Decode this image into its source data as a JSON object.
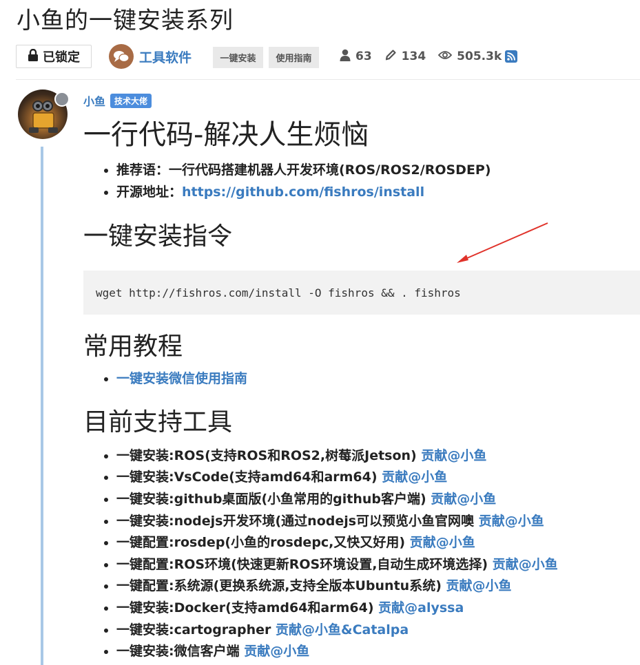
{
  "topic": {
    "title": "小鱼的一键安装系列"
  },
  "meta": {
    "locked_label": "已锁定",
    "category": "工具软件",
    "tags": [
      "一键安装",
      "使用指南"
    ],
    "participants": "63",
    "posts": "134",
    "views": "505.3k",
    "icons": [
      "lock-icon",
      "chat-bubble-icon",
      "user-icon",
      "pencil-icon",
      "eye-icon",
      "rss-icon"
    ]
  },
  "post": {
    "author": "小鱼",
    "author_title": "技术大佬",
    "heading": "一行代码-解决人生烦恼",
    "intro": [
      {
        "text": "推荐语：一行代码搭建机器人开发环境(ROS/ROS2/ROSDEP)",
        "link": ""
      },
      {
        "text": "开源地址：",
        "link": "https://github.com/fishros/install"
      }
    ],
    "install_heading": "一键安装指令",
    "install_command": "wget http://fishros.com/install -O fishros && . fishros",
    "tutorials_heading": "常用教程",
    "tutorials": [
      "一键安装微信使用指南"
    ],
    "tools_heading": "目前支持工具",
    "tools": [
      {
        "text": "一键安装:ROS(支持ROS和ROS2,树莓派Jetson)",
        "contrib": "贡献@小鱼"
      },
      {
        "text": "一键安装:VsCode(支持amd64和arm64)",
        "contrib": "贡献@小鱼"
      },
      {
        "text": "一键安装:github桌面版(小鱼常用的github客户端)",
        "contrib": "贡献@小鱼"
      },
      {
        "text": "一键安装:nodejs开发环境(通过nodejs可以预览小鱼官网噢",
        "contrib": "贡献@小鱼"
      },
      {
        "text": "一键配置:rosdep(小鱼的rosdepc,又快又好用)",
        "contrib": "贡献@小鱼"
      },
      {
        "text": "一键配置:ROS环境(快速更新ROS环境设置,自动生成环境选择)",
        "contrib": "贡献@小鱼"
      },
      {
        "text": "一键配置:系统源(更换系统源,支持全版本Ubuntu系统)",
        "contrib": "贡献@小鱼"
      },
      {
        "text": "一键安装:Docker(支持amd64和arm64)",
        "contrib": "贡献@alyssa"
      },
      {
        "text": "一键安装:cartographer",
        "contrib": "贡献@小鱼&Catalpa"
      },
      {
        "text": "一键安装:微信客户端",
        "contrib": "贡献@小鱼"
      }
    ]
  },
  "colors": {
    "link": "#3a7bbf",
    "badge": "#4c8ddd",
    "thread_line": "#a8c8e6",
    "annotation_arrow": "#e0322a",
    "code_bg": "#f2f2f2"
  }
}
